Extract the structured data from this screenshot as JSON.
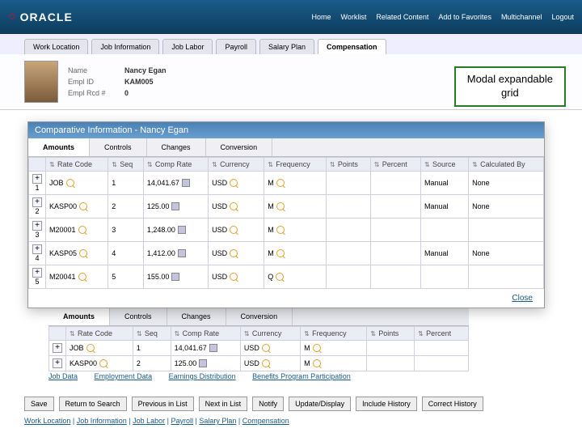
{
  "brand": "ORACLE",
  "topnav": [
    "Home",
    "Worklist",
    "Related Content",
    "Add to Favorites",
    "Multichannel",
    "Logout"
  ],
  "tabs": [
    "Work Location",
    "Job Information",
    "Job Labor",
    "Payroll",
    "Salary Plan",
    "Compensation"
  ],
  "activeTab": 5,
  "employee": {
    "labels": {
      "name": "Name",
      "empId": "Empl ID",
      "rcd": "Empl Rcd #"
    },
    "values": {
      "name": "Nancy Egan",
      "empId": "KAM005",
      "rcd": "0"
    }
  },
  "callout": {
    "line1": "Modal expandable",
    "line2": "grid"
  },
  "modal": {
    "title": "Comparative Information - Nancy Egan",
    "subtabs": [
      "Amounts",
      "Controls",
      "Changes",
      "Conversion"
    ],
    "activeSubtab": 0,
    "columns": [
      "",
      "Rate Code",
      "Seq",
      "Comp Rate",
      "Currency",
      "Frequency",
      "Points",
      "Percent",
      "Source",
      "Calculated By"
    ],
    "rows": [
      {
        "n": "1",
        "rate": "JOB",
        "seq": "1",
        "comp": "14,041.67",
        "cur": "USD",
        "freq": "M",
        "points": "",
        "pct": "",
        "src": "Manual",
        "calc": "None"
      },
      {
        "n": "2",
        "rate": "KASP00",
        "seq": "2",
        "comp": "125.00",
        "cur": "USD",
        "freq": "M",
        "points": "",
        "pct": "",
        "src": "Manual",
        "calc": "None"
      },
      {
        "n": "3",
        "rate": "M20001",
        "seq": "3",
        "comp": "1,248.00",
        "cur": "USD",
        "freq": "M",
        "points": "",
        "pct": "",
        "src": "",
        "calc": ""
      },
      {
        "n": "4",
        "rate": "KASP05",
        "seq": "4",
        "comp": "1,412.00",
        "cur": "USD",
        "freq": "M",
        "points": "",
        "pct": "",
        "src": "Manual",
        "calc": "None"
      },
      {
        "n": "5",
        "rate": "M20041",
        "seq": "5",
        "comp": "155.00",
        "cur": "USD",
        "freq": "Q",
        "points": "",
        "pct": "",
        "src": "",
        "calc": ""
      }
    ],
    "close": "Close"
  },
  "bgGrid": {
    "subtabs": [
      "Amounts",
      "Controls",
      "Changes",
      "Conversion"
    ],
    "columns": [
      "",
      "Rate Code",
      "Seq",
      "Comp Rate",
      "Currency",
      "Frequency",
      "Points",
      "Percent"
    ],
    "rows": [
      {
        "n": "",
        "rate": "JOB",
        "seq": "1",
        "comp": "14,041.67",
        "cur": "USD",
        "freq": "M"
      },
      {
        "n": "",
        "rate": "KASP00",
        "seq": "2",
        "comp": "125.00",
        "cur": "USD",
        "freq": "M"
      }
    ]
  },
  "bottomLinks": [
    "Job Data",
    "Employment Data",
    "Earnings Distribution",
    "Benefits Program Participation"
  ],
  "buttons": [
    "Save",
    "Return to Search",
    "Previous in List",
    "Next in List",
    "Notify",
    "Update/Display",
    "Include History",
    "Correct History"
  ],
  "trail": [
    "Work Location",
    "Job Information",
    "Job Labor",
    "Payroll",
    "Salary Plan",
    "Compensation"
  ]
}
